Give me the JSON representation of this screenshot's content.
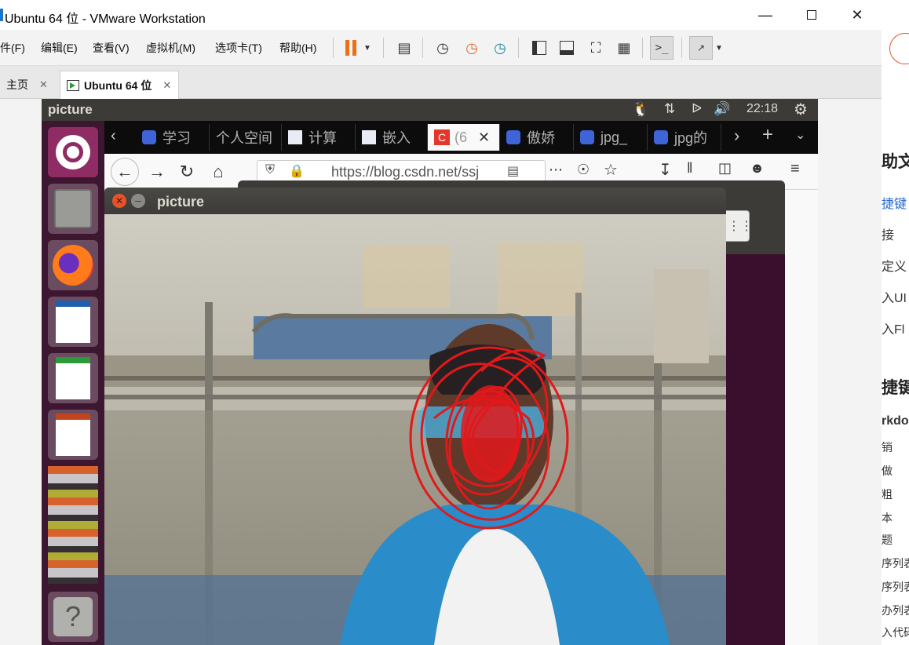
{
  "vmware": {
    "title": "Ubuntu 64 位 - VMware Workstation",
    "menu": [
      "件(F)",
      "编辑(E)",
      "查看(V)",
      "虚拟机(M)",
      "选项卡(T)",
      "帮助(H)"
    ],
    "tabs": [
      {
        "label": "主页"
      },
      {
        "label": "Ubuntu 64 位"
      }
    ]
  },
  "ubuntu": {
    "panel_title": "picture",
    "clock": "22:18"
  },
  "firefox": {
    "tabs": [
      "学习",
      "个人空间",
      "计算",
      "嵌入",
      "(6",
      "傲娇",
      "jpg_",
      "jpg的"
    ],
    "url": "https://blog.csdn.net/ssj"
  },
  "picture_window": {
    "title": "picture"
  },
  "right_panel": {
    "items": [
      "助文",
      "捷键",
      "接",
      "定义",
      "入UI",
      "入Fl",
      "捷键",
      "rkdo",
      "销",
      "做",
      "粗",
      "本",
      "题",
      "序列表",
      "序列表",
      "办列表",
      "入代码"
    ]
  },
  "colors": {
    "ubuntu_panel": "#3c3b37",
    "launcher": "#3d1630",
    "scribble": "#e0191b",
    "pause": "#f06d14"
  }
}
